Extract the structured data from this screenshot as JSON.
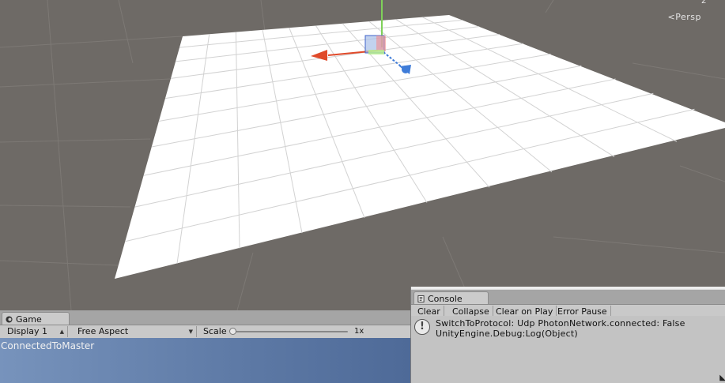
{
  "scene": {
    "persp_label": "Persp",
    "axis_label": "z"
  },
  "game": {
    "tab_label": "Game",
    "display_value": "Display 1",
    "aspect_value": "Free Aspect",
    "scale_label": "Scale",
    "scale_value": "1x",
    "output_text": "ConnectedToMaster"
  },
  "console": {
    "tab_label": "Console",
    "buttons": [
      "Clear",
      "Collapse",
      "Clear on Play",
      "Error Pause"
    ],
    "message_line1": "SwitchToProtocol: Udp PhotonNetwork.connected: False",
    "message_line2": "UnityEngine.Debug:Log(Object)"
  },
  "colors": {
    "scene_background": "#6e6a66",
    "plane": "#ffffff",
    "axis_x": "#e04a2a",
    "axis_y": "#7fd05a",
    "axis_z": "#3f7cd8",
    "game_view_background": "#5d79a5",
    "panel": "#c2c2c2"
  },
  "icons": [
    "scene-gizmo-icon",
    "game-tab-icon",
    "console-tab-icon",
    "warning-icon"
  ]
}
